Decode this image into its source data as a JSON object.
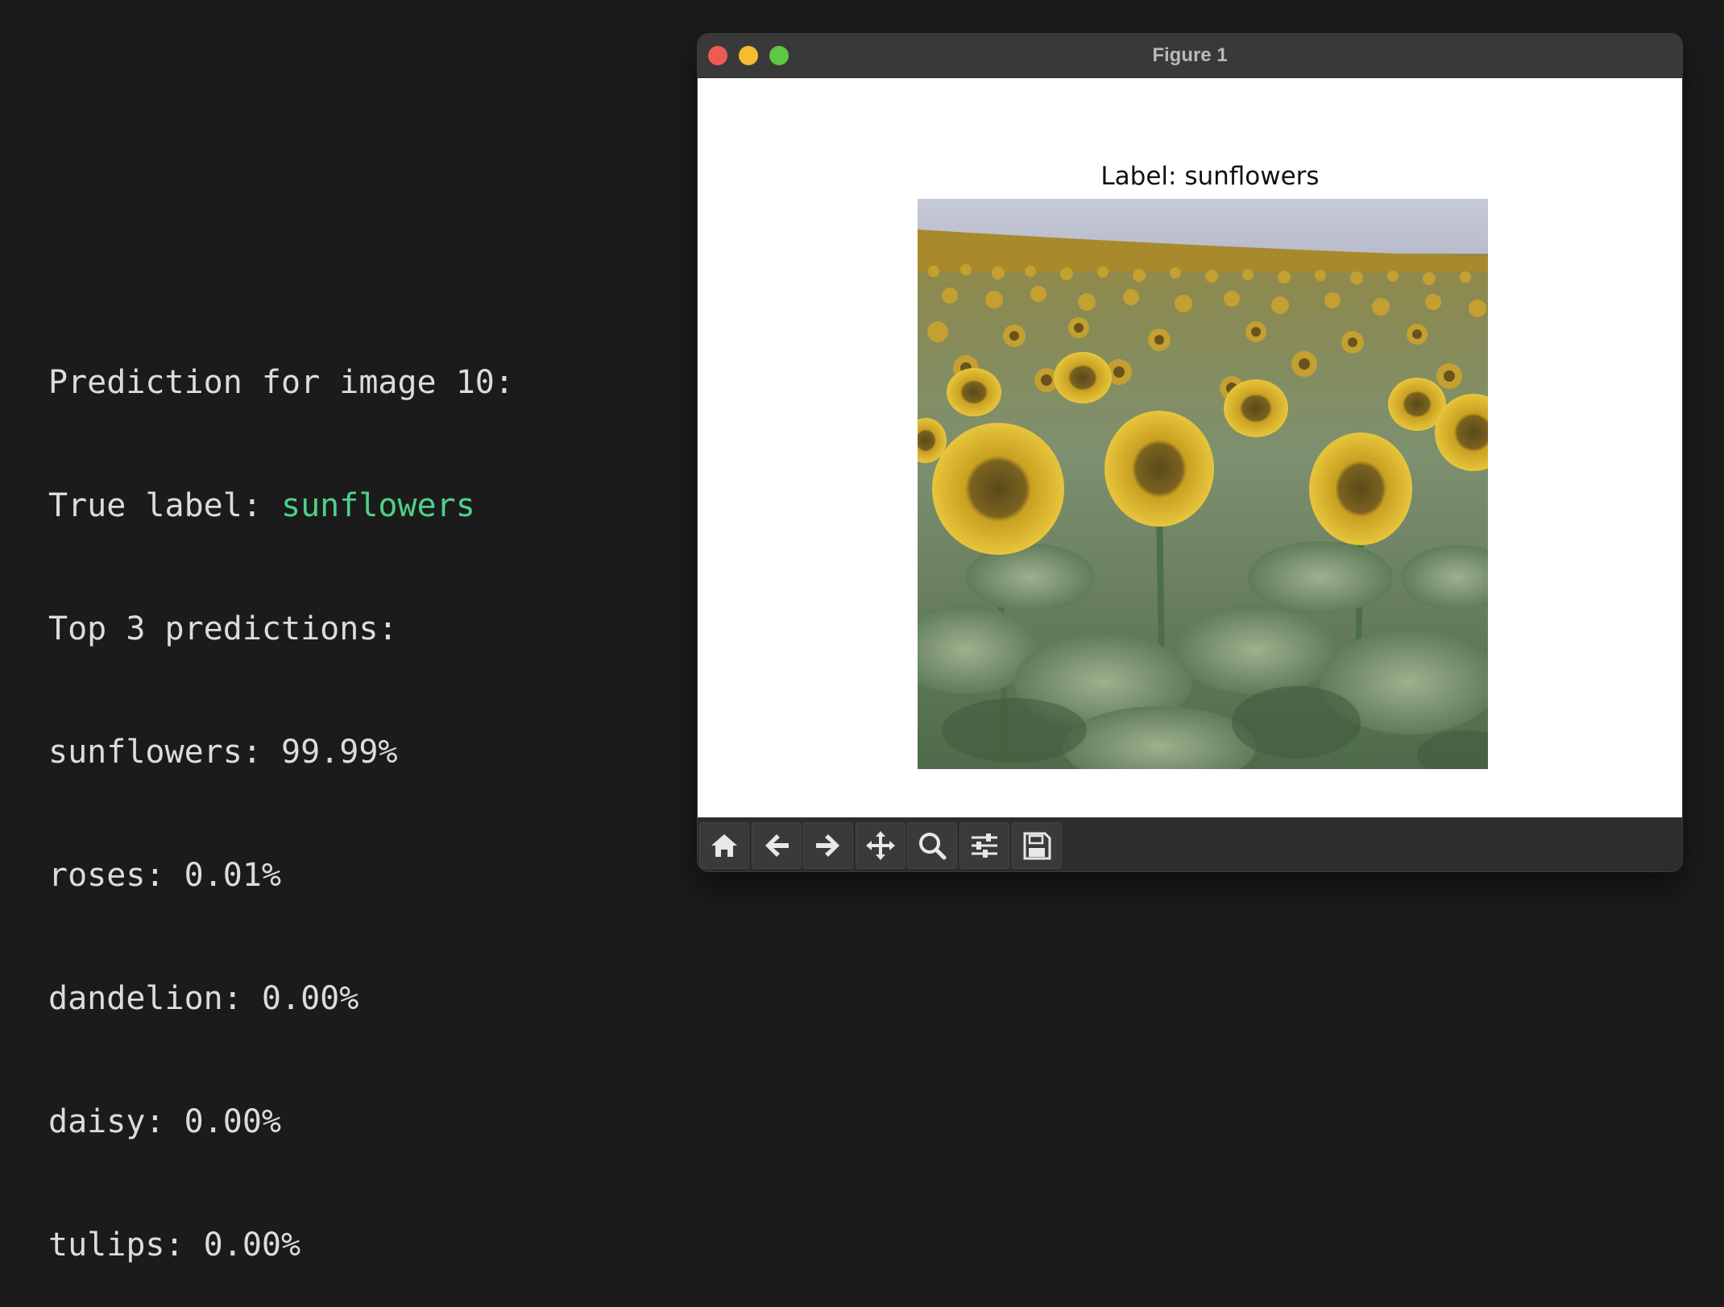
{
  "terminal": {
    "line1": "Prediction for image 10:",
    "true_label_prefix": "True label: ",
    "true_label_value": "sunflowers",
    "top_header": "Top 3 predictions:",
    "predictions": [
      "sunflowers: 99.99%",
      "roses: 0.01%",
      "dandelion: 0.00%",
      "daisy: 0.00%",
      "tulips: 0.00%"
    ]
  },
  "window": {
    "title": "Figure 1",
    "axes_title": "Label: sunflowers"
  },
  "toolbar": {
    "icons": [
      "home-icon",
      "back-arrow-icon",
      "forward-arrow-icon",
      "pan-icon",
      "zoom-icon",
      "configure-subplots-icon",
      "save-icon"
    ]
  },
  "colors": {
    "background": "#1b1b1c",
    "terminal_text": "#dcdcdc",
    "accent_green": "#4fd088",
    "close": "#ee5b53",
    "minimize": "#f5bc31",
    "maximize": "#5dc842"
  }
}
